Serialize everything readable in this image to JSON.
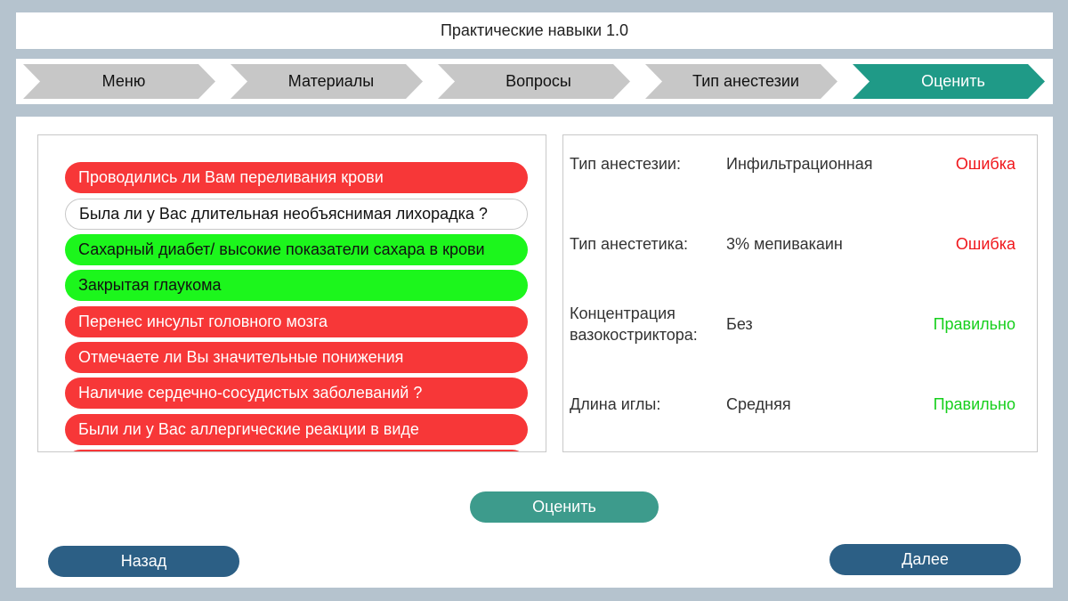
{
  "app": {
    "title": "Практические навыки 1.0"
  },
  "steps": [
    {
      "label": "Меню",
      "active": false
    },
    {
      "label": "Материалы",
      "active": false
    },
    {
      "label": "Вопросы",
      "active": false
    },
    {
      "label": "Тип анестезии",
      "active": false
    },
    {
      "label": "Оценить",
      "active": true
    }
  ],
  "colors": {
    "step_inactive": "#c7c7c7",
    "step_active": "#1f9a87",
    "item_red": "#f73738",
    "item_green": "#1cf61c",
    "status_error": "#f0161b",
    "status_ok": "#16cf1c",
    "button_teal": "#3d9b8c",
    "button_navy": "#2c5f85"
  },
  "questions": [
    {
      "text": "Проводились ли Вам переливания крови",
      "state": "red"
    },
    {
      "text": "Была ли у Вас длительная необъяснимая лихорадка ?",
      "state": "white"
    },
    {
      "text": "Сахарный диабет/ высокие показатели сахара в крови",
      "state": "green"
    },
    {
      "text": "Закрытая глаукома",
      "state": "green"
    },
    {
      "text": "Перенес инсульт головного мозга",
      "state": "red"
    },
    {
      "text": "Отмечаете ли Вы значительные понижения",
      "state": "red"
    },
    {
      "text": "Наличие сердечно-сосудистых заболеваний ?",
      "state": "red"
    },
    {
      "text": "Были ли у Вас аллергические реакции в виде",
      "state": "red"
    },
    {
      "text": "",
      "state": "red"
    }
  ],
  "results": [
    {
      "label": "Тип анестезии:",
      "value": "Инфильтрационная",
      "status": "Ошибка",
      "status_type": "err"
    },
    {
      "label": "Тип анестетика:",
      "value": "3% мепивакаин",
      "status": "Ошибка",
      "status_type": "err"
    },
    {
      "label": "Концентрация вазокостриктора:",
      "value": "Без",
      "status": "Правильно",
      "status_type": "ok"
    },
    {
      "label": "Длина иглы:",
      "value": "Средняя",
      "status": "Правильно",
      "status_type": "ok"
    }
  ],
  "buttons": {
    "evaluate": "Оценить",
    "back": "Назад",
    "next": "Далее"
  }
}
